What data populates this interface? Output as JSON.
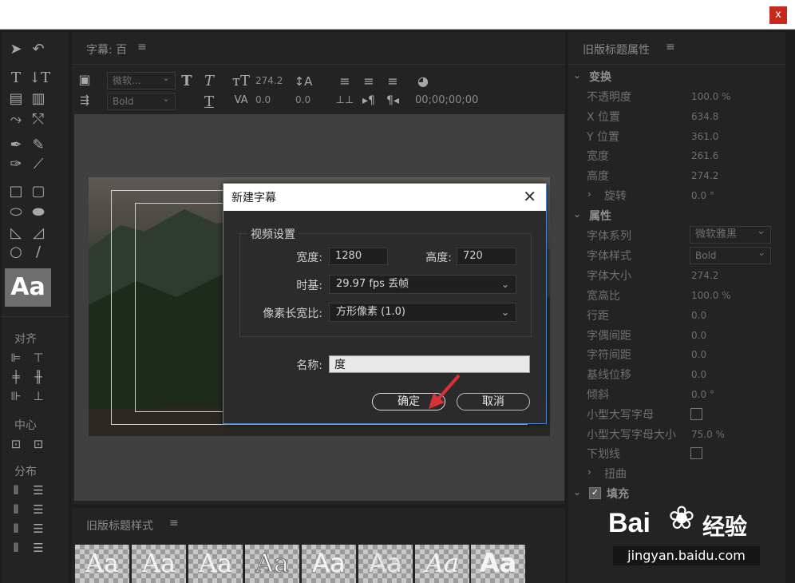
{
  "window": {
    "close_label": "x"
  },
  "tools_panel": {
    "selected_tool_label": "Aa",
    "align_label": "对齐",
    "center_label": "中心",
    "distribute_label": "分布"
  },
  "title_panel": {
    "tab_label": "字幕: 百",
    "font_family": "微软...",
    "font_style": "Bold",
    "font_size": "274.2",
    "kerning": "0.0",
    "leading": "0.0",
    "timecode": "00;00;00;00"
  },
  "styles_panel": {
    "label": "旧版标题样式",
    "swatches": [
      "Aa",
      "Aa",
      "Aa",
      "Aa",
      "Aa",
      "Aa",
      "Aa",
      "Aa"
    ]
  },
  "properties_panel": {
    "label": "旧版标题属性",
    "transform_header": "变换",
    "opacity": {
      "name": "不透明度",
      "value": "100.0 %"
    },
    "x_pos": {
      "name": "X 位置",
      "value": "634.8"
    },
    "y_pos": {
      "name": "Y 位置",
      "value": "361.0"
    },
    "width": {
      "name": "宽度",
      "value": "261.6"
    },
    "height": {
      "name": "高度",
      "value": "274.2"
    },
    "rotation": {
      "name": "旋转",
      "value": "0.0 °"
    },
    "props_header": "属性",
    "font_family": {
      "name": "字体系列",
      "value": "微软雅黑"
    },
    "font_style": {
      "name": "字体样式",
      "value": "Bold"
    },
    "font_size": {
      "name": "字体大小",
      "value": "274.2"
    },
    "aspect": {
      "name": "宽高比",
      "value": "100.0 %"
    },
    "leading": {
      "name": "行距",
      "value": "0.0"
    },
    "kerning": {
      "name": "字偶间距",
      "value": "0.0"
    },
    "tracking": {
      "name": "字符间距",
      "value": "0.0"
    },
    "baseline": {
      "name": "基线位移",
      "value": "0.0"
    },
    "slant": {
      "name": "倾斜",
      "value": "0.0 °"
    },
    "small_caps": {
      "name": "小型大写字母"
    },
    "small_caps_size": {
      "name": "小型大写字母大小",
      "value": "75.0 %"
    },
    "underline": {
      "name": "下划线"
    },
    "distort": {
      "name": "扭曲"
    },
    "fill_header": "填充"
  },
  "dialog": {
    "title": "新建字幕",
    "close_glyph": "✕",
    "video_settings_label": "视频设置",
    "width_label": "宽度:",
    "width_value": "1280",
    "height_label": "高度:",
    "height_value": "720",
    "timebase_label": "时基:",
    "timebase_value": "29.97 fps 丢帧",
    "par_label": "像素长宽比:",
    "par_value": "方形像素 (1.0)",
    "name_label": "名称:",
    "name_value": "度",
    "ok_label": "确定",
    "cancel_label": "取消"
  },
  "watermark": {
    "brand_left": "Bai",
    "brand_right": "经验",
    "url": "jingyan.baidu.com"
  }
}
